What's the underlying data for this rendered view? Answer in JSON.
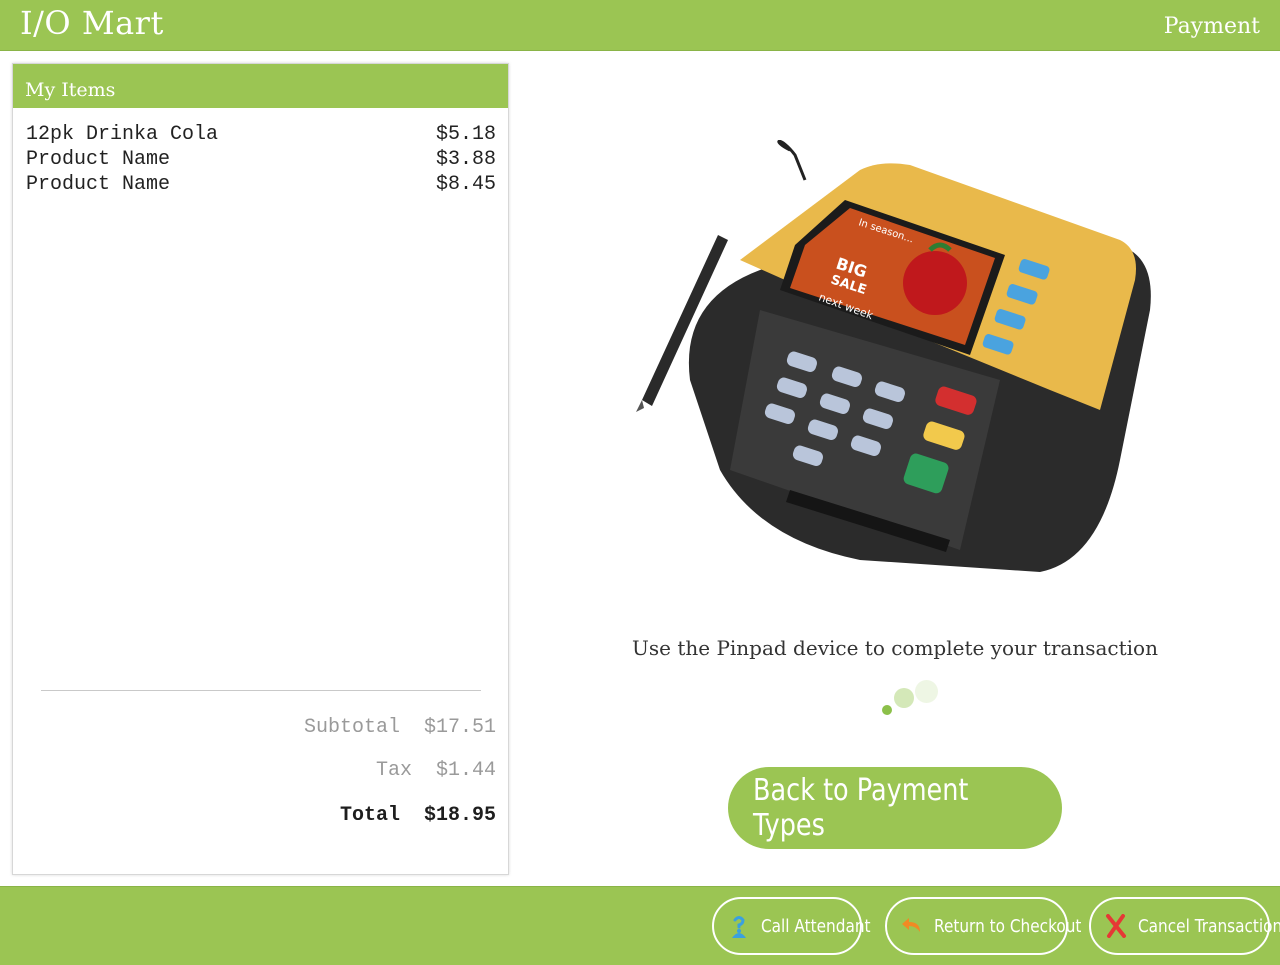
{
  "app": {
    "brand": "I/O Mart",
    "page_title": "Payment"
  },
  "items_panel": {
    "header": "My Items",
    "items": [
      {
        "name": "12pk Drinka Cola",
        "price": "$5.18"
      },
      {
        "name": "Product Name",
        "price": "$3.88"
      },
      {
        "name": "Product Name",
        "price": "$8.45"
      }
    ],
    "subtotal_label": "Subtotal",
    "subtotal_value": "$17.51",
    "tax_label": "Tax",
    "tax_value": "$1.44",
    "total_label": "Total",
    "total_value": "$18.95"
  },
  "main": {
    "device_screen": {
      "line1": "In season...",
      "line2": "BIG",
      "line3": "SALE",
      "line4": "next week"
    },
    "instruction": "Use the Pinpad device to complete your transaction",
    "back_button": "Back to Payment Types"
  },
  "footer": {
    "call_attendant": "Call Attendant",
    "return_checkout": "Return to Checkout",
    "cancel_transaction": "Cancel Transaction"
  },
  "colors": {
    "accent": "#9bc553",
    "cancel_icon": "#e53935",
    "return_icon": "#f08a24",
    "attendant_icon": "#3aa0e0"
  },
  "icons": [
    "question-person-icon",
    "return-arrow-icon",
    "x-cancel-icon",
    "loading-spinner"
  ]
}
